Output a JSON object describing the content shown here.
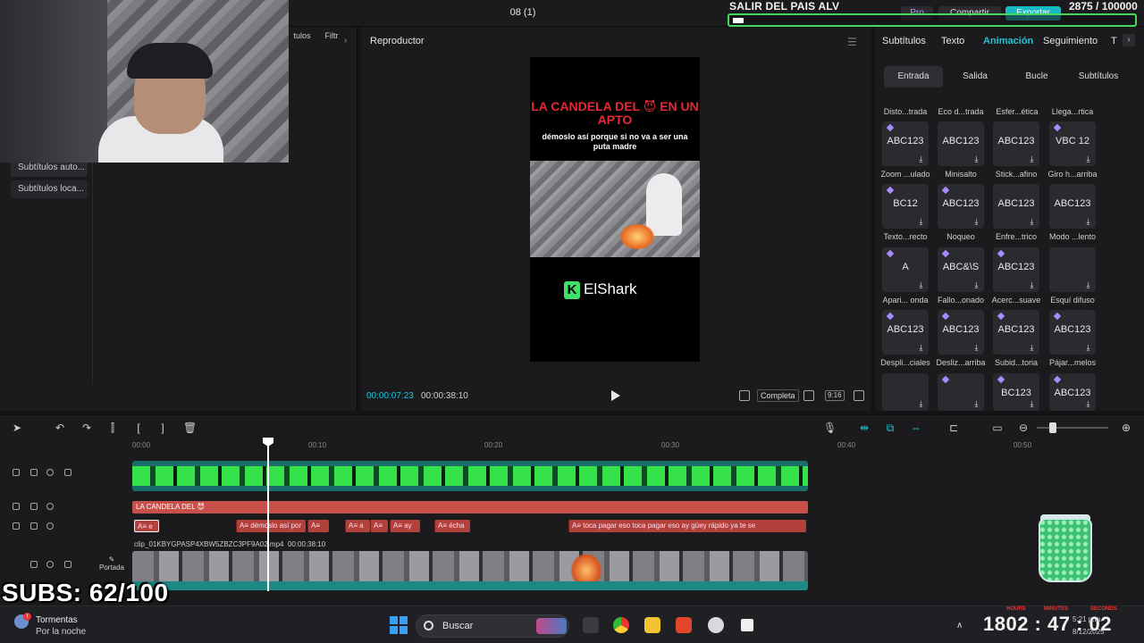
{
  "window": {
    "project_title": "08 (1)",
    "pro_label": "Pro",
    "share_label": "Compartir",
    "export_label": "Exportar"
  },
  "stream_overlay": {
    "goal_title": "SALIR DEL PAIS ALV",
    "goal_progress": 0.028,
    "goal_counter": "2875 / 100000",
    "subs_text": "SUBS: 62/100"
  },
  "left_panel": {
    "tabs": [
      "tulos",
      "Filtr"
    ],
    "items": [
      "Subtítulos auto...",
      "Subtítulos loca..."
    ]
  },
  "player": {
    "title": "Reproductor",
    "video_title": "LA CANDELA DEL 😈 EN UN APTO",
    "video_subtitle": "démoslo así porque si no va a ser una puta madre",
    "logo_text": "ElShark",
    "logo_letter": "K",
    "time_current": "00:00:07:23",
    "time_total": "00:00:38:10",
    "completa_label": "Completa",
    "ratio_label": "9:16"
  },
  "right_panel": {
    "tabs": [
      "Subtítulos",
      "Texto",
      "Animación",
      "Seguimiento",
      "T"
    ],
    "active_tab": "Animación",
    "subtabs": [
      "Entrada",
      "Salida",
      "Bucle",
      "Subtítulos"
    ],
    "active_subtab": "Entrada",
    "row0_labels": [
      "Disto...trada",
      "Eco d...trada",
      "Esfer...ética",
      "Llega...rtica"
    ],
    "cards": [
      {
        "text": "ABC123",
        "label": "Zoom ...ulado",
        "gem": true
      },
      {
        "text": "ABC123",
        "label": "Minisalto",
        "gem": false
      },
      {
        "text": "ABC123",
        "label": "Stick...afino",
        "gem": false
      },
      {
        "text": "VBC 12",
        "label": "Giro h...arriba",
        "gem": true
      },
      {
        "text": "BC12",
        "label": "Texto...recto",
        "gem": true
      },
      {
        "text": "ABC123",
        "label": "Noqueo",
        "gem": true
      },
      {
        "text": "ABC123",
        "label": "Enfre...trico",
        "gem": false
      },
      {
        "text": "ABC123",
        "label": "Modo ...lento",
        "gem": false
      },
      {
        "text": "A",
        "label": "Apari... onda",
        "gem": true
      },
      {
        "text": "ABC&\\S",
        "label": "Fallo...onado",
        "gem": true
      },
      {
        "text": "ABC123",
        "label": "Acerc...suave",
        "gem": true
      },
      {
        "text": "",
        "label": "Esquí difuso",
        "gem": false
      },
      {
        "text": "ABC123",
        "label": "Despli...ciales",
        "gem": true
      },
      {
        "text": "ABC123",
        "label": "Desliz...arriba",
        "gem": true
      },
      {
        "text": "ABC123",
        "label": "Subid...toria",
        "gem": true
      },
      {
        "text": "ABC123",
        "label": "Pájar...melos",
        "gem": true
      },
      {
        "text": "",
        "label": "",
        "gem": false
      },
      {
        "text": "",
        "label": "",
        "gem": true
      },
      {
        "text": "BC123",
        "label": "",
        "gem": true
      },
      {
        "text": "ABC123",
        "label": "",
        "gem": true
      }
    ]
  },
  "timeline": {
    "ticks": [
      "00:00",
      "00:10",
      "00:20",
      "00:30",
      "00:40",
      "00:50"
    ],
    "playhead_time": "00:07",
    "title_clip": "LA CANDELA DEL 😈",
    "sub_clips": [
      {
        "text": "A≡ e"
      },
      {
        "text": "A≡ démoslo así por"
      },
      {
        "text": "A≡"
      },
      {
        "text": "A≡ a"
      },
      {
        "text": "A≡"
      },
      {
        "text": "A≡ ay"
      },
      {
        "text": "A≡ écha"
      },
      {
        "text": "A≡ toca pagar eso toca pagar eso ay güey rápido ya te se"
      }
    ],
    "video_clip_name": "clip_01KBYGPASP4XBW5ZBZC3PF9A02.mp4",
    "video_clip_duration": "00:00:38:10",
    "portada_label": "Portada"
  },
  "taskbar": {
    "weather_title": "Tormentas",
    "weather_subtitle": "Por la noche",
    "search_placeholder": "Buscar",
    "clock_big": "1802 : 47 : 02",
    "clock_labels": [
      "HOURS",
      "MINUTES",
      "SECONDS"
    ],
    "time_small": "5:21 p.m.",
    "date_small": "8/12/2025"
  },
  "colors": {
    "accent": "#21c3d6",
    "title_track": "#c8504a",
    "export": "#19b8c6",
    "goal_border": "#46d85c"
  }
}
